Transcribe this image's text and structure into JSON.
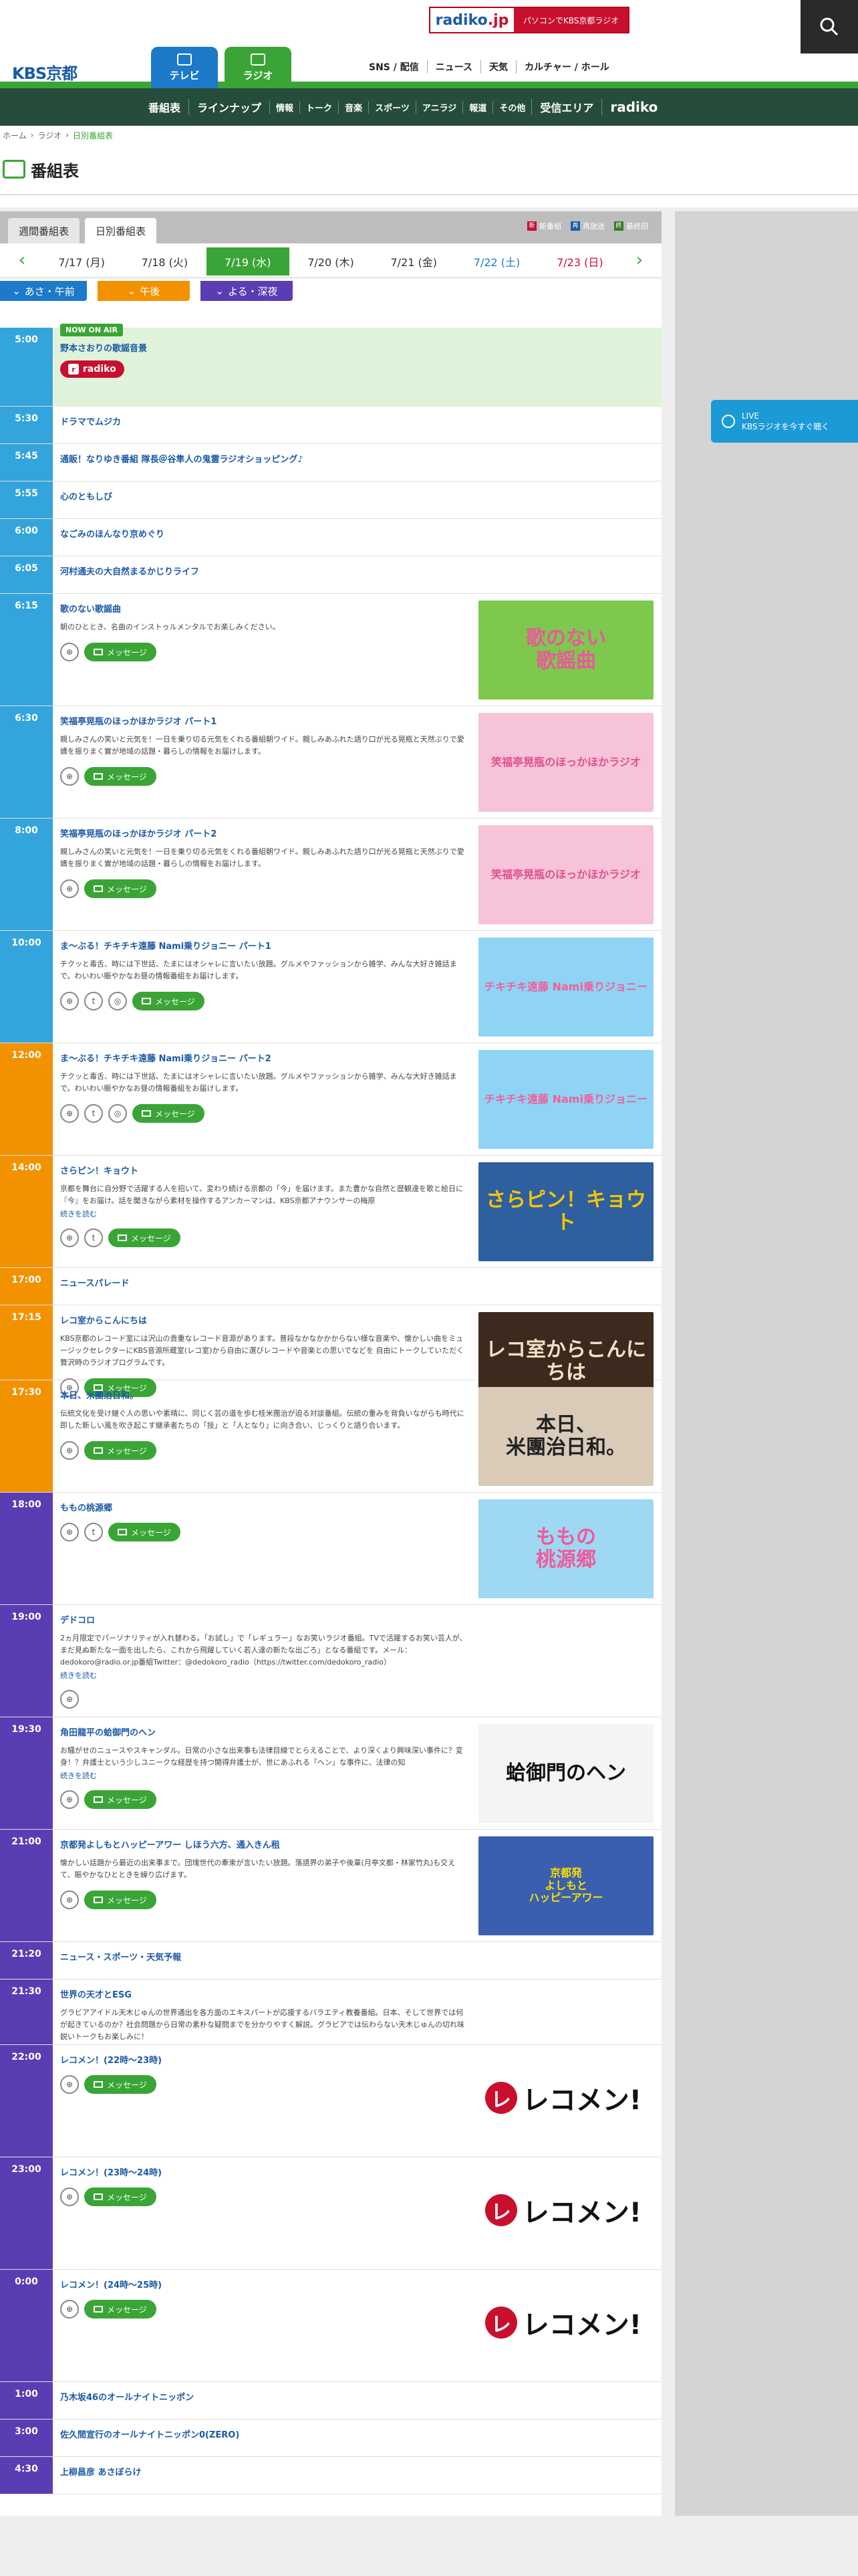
{
  "header": {
    "banner_logo": "radiko",
    "banner_logo_jp": ".jp",
    "banner_text": "パソコンでKBS京都ラジオ",
    "site_logo": "KBS京都",
    "tabs": [
      {
        "label": "テレビ"
      },
      {
        "label": "ラジオ"
      }
    ],
    "util_nav": [
      "SNS / 配信",
      "ニュース",
      "天気",
      "カルチャー / ホール"
    ]
  },
  "gnav": {
    "items": [
      "番組表",
      "ラインナップ",
      "情報",
      "トーク",
      "音楽",
      "スポーツ",
      "アニラジ",
      "報道",
      "その他",
      "受信エリア",
      "radiko"
    ]
  },
  "breadcrumb": [
    "ホーム",
    "ラジオ",
    "日別番組表"
  ],
  "page_title": "番組表",
  "subtabs": [
    "週間番組表",
    "日別番組表"
  ],
  "legend": [
    {
      "label": "新番組",
      "mark": "新",
      "color": "#c8102e"
    },
    {
      "label": "再放送",
      "mark": "再",
      "color": "#1c5aa6"
    },
    {
      "label": "最終回",
      "mark": "終",
      "color": "#3a7a2a"
    }
  ],
  "dates": [
    "7/17 (月)",
    "7/18 (火)",
    "7/19 (水)",
    "7/20 (木)",
    "7/21 (金)",
    "7/22 (土)",
    "7/23 (日)"
  ],
  "periods": [
    "あさ・午前",
    "午後",
    "よる・深夜"
  ],
  "live": {
    "title": "LIVE",
    "text": "KBSラジオを今すぐ聴く"
  },
  "onair_label": "NOW ON AIR",
  "message_label": "メッセージ",
  "more_label": "続きを読む",
  "programs": [
    {
      "time": "5:00",
      "title": "野本さおりの歌謡音景",
      "onair": true
    },
    {
      "time": "5:30",
      "title": "ドラマでムジカ"
    },
    {
      "time": "5:45",
      "title": "通販！なりゆき番組 隊長＠谷隼人の鬼霊ラジオショッピング♪"
    },
    {
      "time": "5:55",
      "title": "心のともしび"
    },
    {
      "time": "6:00",
      "title": "なごみのほんなり京めぐり"
    },
    {
      "time": "6:05",
      "title": "河村通夫の大自然まるかじりライフ"
    },
    {
      "time": "6:15",
      "title": "歌のない歌謡曲",
      "desc": "朝のひととき、名曲のインストゥルメンタルでお楽しみください。",
      "thumb": "歌のない\n歌謡曲"
    },
    {
      "time": "6:30",
      "title": "笑福亭晃瓶のほっかほかラジオ パート1",
      "desc": "親しみさんの笑いと元気を！一日を乗り切る元気をくれる番組朝ワイド。親しみあふれた語り口が光る晃瓶と天然ぶりで愛嬌を振りまく實が地域の話題・暮らしの情報をお届けします。",
      "thumb": "笑福亭晃瓶のほっかほかラジオ"
    },
    {
      "time": "8:00",
      "title": "笑福亭晃瓶のほっかほかラジオ パート2",
      "desc": "親しみさんの笑いと元気を！一日を乗り切る元気をくれる番組朝ワイド。親しみあふれた語り口が光る晃瓶と天然ぶりで愛嬌を振りまく實が地域の話題・暮らしの情報をお届けします。",
      "thumb": "笑福亭晃瓶のほっかほかラジオ"
    },
    {
      "time": "10:00",
      "title": "ま〜ぶる！チキチキ遠藤 Nami乗りジョニー パート1",
      "desc": "チクッと毒舌、時には下世話、たまにはオシャレに言いたい放題。グルメやファッションから雑学、みんな大好き雑話まで。わいわい賑やかなお昼の情報番組をお届けします。",
      "thumb": "チキチキ遠藤 Nami乗りジョニー"
    },
    {
      "time": "12:00",
      "title": "ま〜ぶる！チキチキ遠藤 Nami乗りジョニー パート2",
      "desc": "チクッと毒舌、時には下世話、たまにはオシャレに言いたい放題。グルメやファッションから雑学、みんな大好き雑話まで。わいわい賑やかなお昼の情報番組をお届けします。",
      "thumb": "チキチキ遠藤 Nami乗りジョニー"
    },
    {
      "time": "14:00",
      "title": "さらピン！キョウト",
      "desc": "京都を舞台に自分野で活躍する人を招いて、変わり続ける京都の「今」を届けます。また豊かな自然と歴観達を歌と絵日に『今』をお届け。話を聞きながら素材を操作するアンカーマンは、KBS京都アナウンサーの梅原",
      "more": true,
      "thumb": "さらピン！キョウト"
    },
    {
      "time": "17:00",
      "title": "ニュースパレード"
    },
    {
      "time": "17:15",
      "title": "レコ室からこんにちは",
      "desc": "KBS京都のレコード室には沢山の貴重なレコード音源があります。普段なかなかかからない様な音楽や、懐かしい曲をミュージックセレクターにKBS音源所蔵室(レコ室)から自由に選びレコードや音楽との思いでなどを 自由にトークしていただく贅沢時のラジオプログラムです。",
      "thumb": "レコ室からこんにちは"
    },
    {
      "time": "17:30",
      "title": "本日、米團治日和。",
      "desc": "伝統文化を受け継ぐ人の思いや素晴に、同じく芸の道を歩む桂米團治が迫る対談番組。伝統の重みを背負いながらも時代に即した新しい風を吹き起こす継承者たちの「技」と「人となり」に向き合い、じっくりと語り合います。",
      "thumb": "本日、\n米團治日和。"
    },
    {
      "time": "18:00",
      "title": "ももの桃源郷",
      "thumb": "ももの\n桃源郷"
    },
    {
      "time": "19:00",
      "title": "デドコロ",
      "desc": "2ヵ月限定でパーソナリティが入れ替わる。「お試し」で「レギュラー」なお笑いラジオ番組。TVで活躍するお笑い芸人が、まだ見ぬ新たな一面を出したら、これから飛躍していく若人達の新たな出ごろ」となる番組です。メール：dedokoro@radio.or.jp番組Twitter：@dedokoro_radio（https://twitter.com/dedokoro_radio）",
      "more": true
    },
    {
      "time": "19:30",
      "title": "角田龍平の蛤御門のヘン",
      "desc": "お騒がせのニュースやスキャンダル。日常の小さな出来事も法律目線でとらえることで、より深くより興味深い事件に？変身！？弁護士という少しユニークな経歴を持つ開得弁護士が、世にあふれる「ヘン」な事件に、法律の知",
      "more": true,
      "thumb": "蛤御門のヘン"
    },
    {
      "time": "21:00",
      "title": "京都発よしもとハッピーアワー しほう六方、通入きん租",
      "desc": "懐かしい話題から最近の出来事まで。団塊世代の牽束が言いたい放題。落語界の弟子や後輩(月亭文都・林家竹丸)も交えて、賑やかなひとときを繰り広げます。",
      "thumb": "京都発\nよしもと\nハッピーアワー"
    },
    {
      "time": "21:20",
      "title": "ニュース・スポーツ・天気予報"
    },
    {
      "time": "21:30",
      "title": "世界の天才とESG",
      "desc": "グラビアアイドル天木じゅんの世界通出を各方面のエキスパートが応援するバラエティ教養番組。日本、そして世界では何が起きているのか？社会問題から日常の素朴な疑問までを分かりやすく解説。グラビアでは伝わらない天木じゅんの切れ味鋭いトークもお楽しみに！"
    },
    {
      "time": "22:00",
      "title": "レコメン！(22時〜23時)",
      "recomen": true
    },
    {
      "time": "23:00",
      "title": "レコメン！(23時〜24時)",
      "recomen": true
    },
    {
      "time": "0:00",
      "title": "レコメン！(24時〜25時)",
      "recomen": true
    },
    {
      "time": "1:00",
      "title": "乃木坂46のオールナイトニッポン"
    },
    {
      "time": "3:00",
      "title": "佐久間宣行のオールナイトニッポン0(ZERO)"
    },
    {
      "time": "4:30",
      "title": "上柳昌彦 あさぼらけ"
    }
  ],
  "recomen_text": "レコメン!",
  "radiko_button": "radiko"
}
